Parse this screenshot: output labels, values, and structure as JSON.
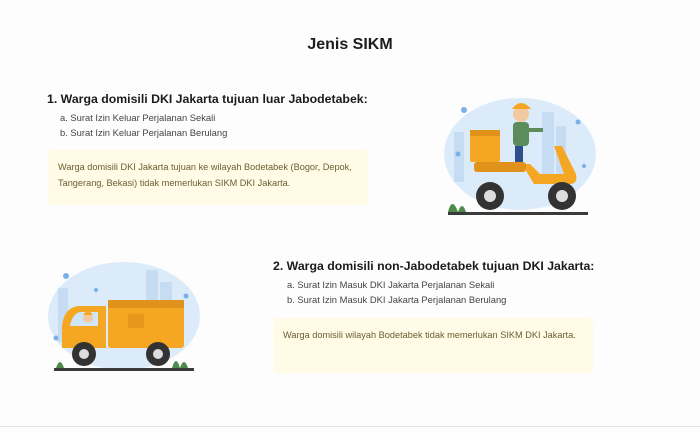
{
  "page": {
    "title": "Jenis SIKM"
  },
  "sections": [
    {
      "heading": "1. Warga domisili DKI Jakarta tujuan luar Jabodetabek:",
      "items": [
        "a. Surat Izin Keluar Perjalanan Sekali",
        "b. Surat Izin Keluar Perjalanan Berulang"
      ],
      "note": "Warga domisili DKI Jakarta tujuan ke wilayah Bodetabek (Bogor, Depok, Tangerang, Bekasi) tidak memerlukan SIKM DKI Jakarta.",
      "illustration": "scooter-delivery-illustration"
    },
    {
      "heading": "2. Warga domisili non-Jabodetabek tujuan DKI Jakarta:",
      "items": [
        "a. Surat Izin Masuk DKI Jakarta Perjalanan Sekali",
        "b. Surat Izin Masuk DKI Jakarta Perjalanan Berulang"
      ],
      "note": "Warga domisili wilayah Bodetabek tidak memerlukan SIKM DKI Jakarta.",
      "illustration": "truck-delivery-illustration"
    }
  ],
  "colors": {
    "accent_orange": "#f5a623",
    "blob_blue": "#dcebf9",
    "note_bg": "#fffbe6"
  }
}
